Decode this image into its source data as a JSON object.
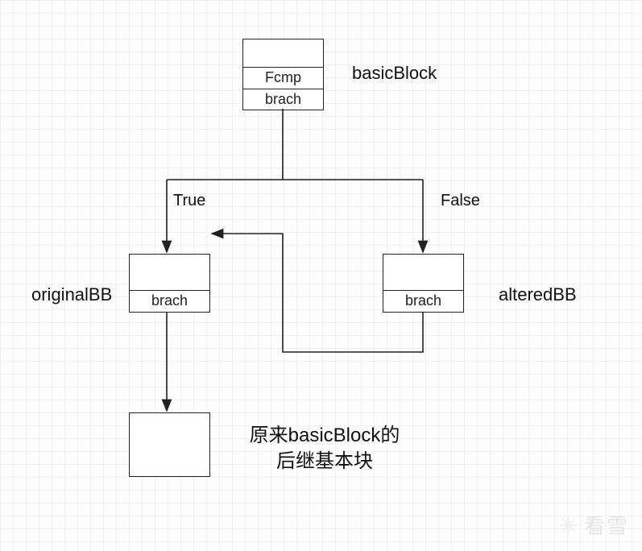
{
  "nodes": {
    "basicBlock": {
      "label": "basicBlock",
      "rows": [
        "Fcmp",
        "brach"
      ]
    },
    "originalBB": {
      "label": "originalBB",
      "rows": [
        "brach"
      ]
    },
    "alteredBB": {
      "label": "alteredBB",
      "rows": [
        "brach"
      ]
    },
    "successor": {
      "label_line1": "原来basicBlock的",
      "label_line2": "后继基本块"
    }
  },
  "edges": {
    "true_label": "True",
    "false_label": "False"
  },
  "watermark": "看雪"
}
